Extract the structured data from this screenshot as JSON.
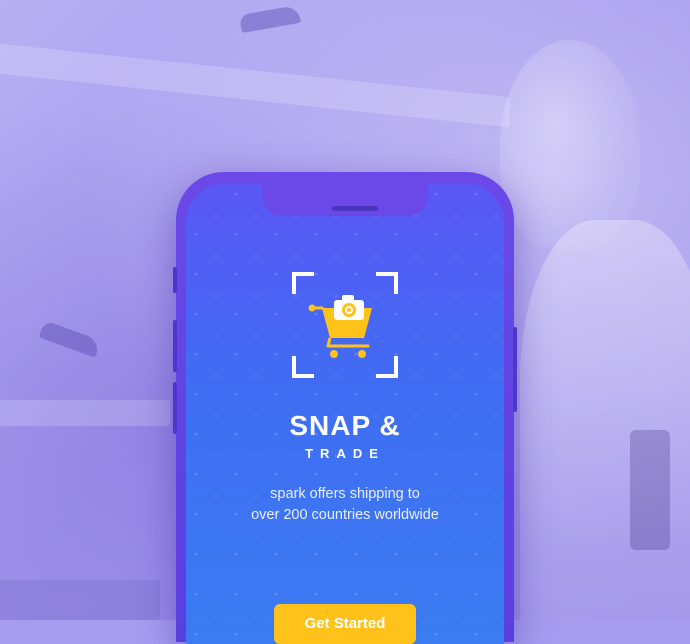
{
  "app": {
    "title": "SNAP &",
    "subtitle": "TRADE"
  },
  "tagline": {
    "line1": "spark offers shipping to",
    "line2": "over 200 countries worldwide"
  },
  "cta": {
    "label": "Get Started"
  },
  "colors": {
    "screen_top": "#5a57f4",
    "screen_bottom": "#3b7cf2",
    "phone_frame": "#6a49e8",
    "accent": "#ffc21a",
    "background_overlay": "#a89cf0"
  },
  "icons": {
    "logo": "camera-cart-icon",
    "frame": "scan-frame-icon"
  }
}
